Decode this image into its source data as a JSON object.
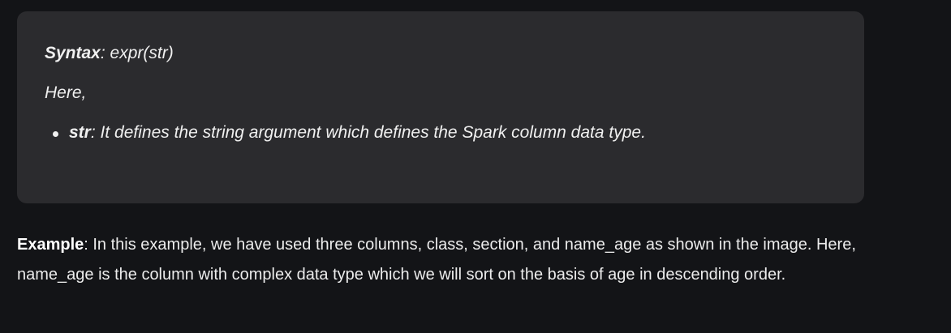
{
  "syntax_box": {
    "syntax_label": "Syntax",
    "syntax_value": ": expr(str)",
    "here_text": "Here,",
    "params": [
      {
        "name": "str",
        "description": ": It defines the string argument which defines the Spark column data type."
      }
    ]
  },
  "example": {
    "label": "Example",
    "text": ": In this example, we have used three columns, class, section, and name_age as shown in the image. Here, name_age is the column with complex data type which we will sort on the basis of age in descending order."
  }
}
